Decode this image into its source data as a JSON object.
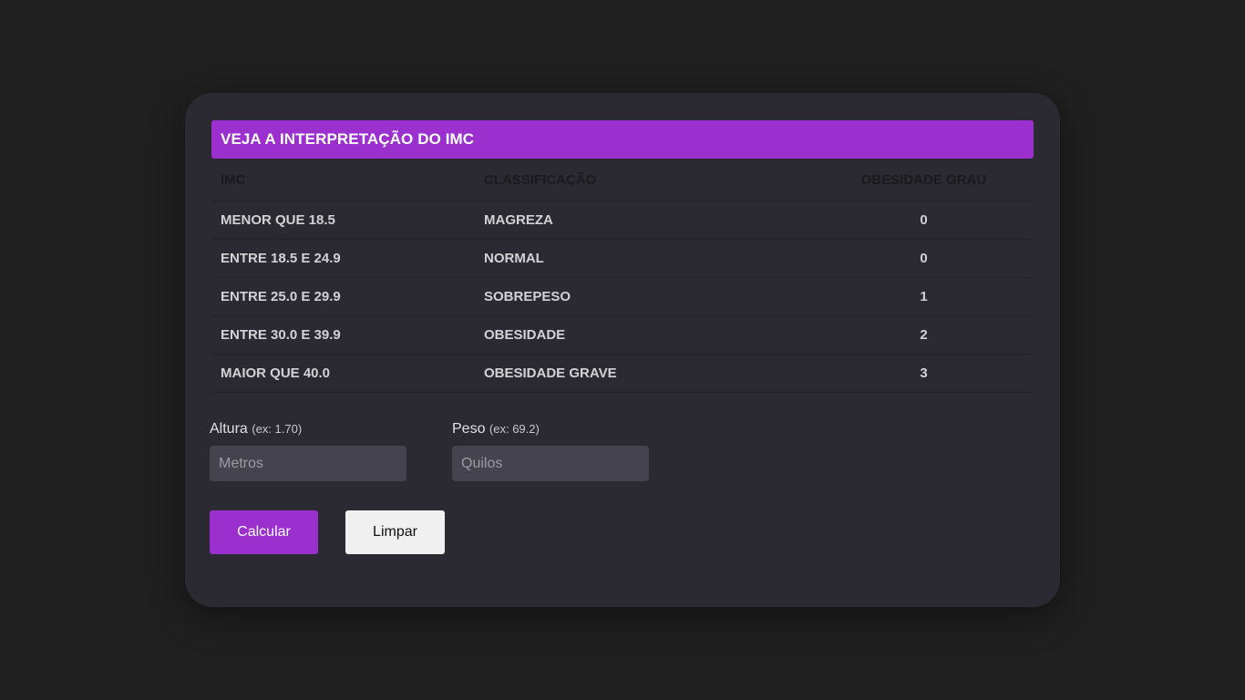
{
  "banner": {
    "title": "VEJA A INTERPRETAÇÃO DO IMC"
  },
  "table": {
    "headers": [
      "IMC",
      "CLASSIFICAÇÃO",
      "OBESIDADE GRAU"
    ],
    "rows": [
      [
        "MENOR QUE 18.5",
        "MAGREZA",
        "0"
      ],
      [
        "ENTRE 18.5 E 24.9",
        "NORMAL",
        "0"
      ],
      [
        "ENTRE 25.0 E 29.9",
        "SOBREPESO",
        "1"
      ],
      [
        "ENTRE 30.0 E 39.9",
        "OBESIDADE",
        "2"
      ],
      [
        "MAIOR QUE 40.0",
        "OBESIDADE GRAVE",
        "3"
      ]
    ]
  },
  "form": {
    "height": {
      "label": "Altura",
      "hint": "(ex: 1.70)",
      "placeholder": "Metros",
      "value": ""
    },
    "weight": {
      "label": "Peso",
      "hint": "(ex: 69.2)",
      "placeholder": "Quilos",
      "value": ""
    }
  },
  "buttons": {
    "calculate": "Calcular",
    "clear": "Limpar"
  },
  "colors": {
    "accent": "#9b30cf",
    "card": "#2b2a33",
    "background": "#202020"
  }
}
